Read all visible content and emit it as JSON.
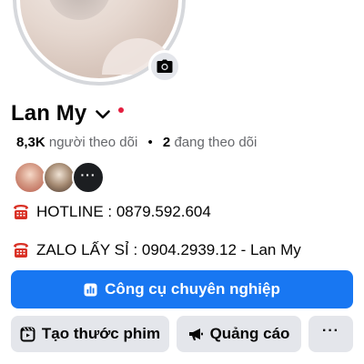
{
  "profile": {
    "name": "Lan My",
    "followers_count": "8,3K",
    "followers_label": "người theo dõi",
    "separator": "•",
    "following_count": "2",
    "following_label": "đang theo dõi"
  },
  "icons": {
    "camera": "camera-icon",
    "chevron": "chevron-down-icon",
    "phone": "telephone-icon",
    "dashboard": "dashboard-icon",
    "reel": "reel-icon",
    "megaphone": "megaphone-icon",
    "more": "more-icon"
  },
  "friends": {
    "more_label": "···"
  },
  "bio": {
    "line1": "HOTLINE : 0879.592.604",
    "line2": "ZALO LẤY SỈ : 0904.2939.12 - Lan My"
  },
  "actions": {
    "primary_label": "Công cụ chuyên nghiệp",
    "reel_label": "Tạo thước phim",
    "ads_label": "Quảng cáo",
    "more_label": "···"
  },
  "colors": {
    "accent": "#1877f2",
    "secondary_button": "#e4e6eb",
    "notification_dot": "#e41e3f",
    "muted_text": "#65676b"
  }
}
